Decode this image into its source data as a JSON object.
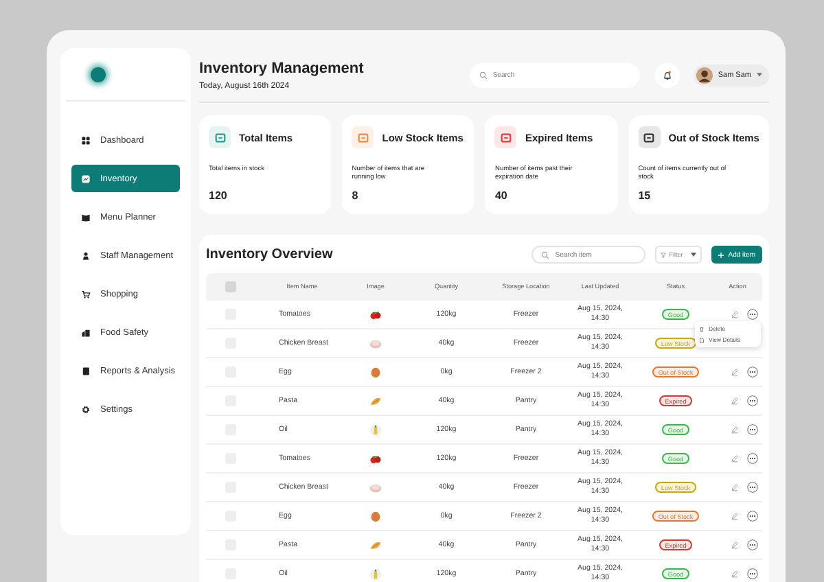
{
  "sidebar": {
    "items": [
      {
        "label": "Dashboard",
        "selected": false
      },
      {
        "label": "Inventory",
        "selected": true
      },
      {
        "label": "Menu Planner",
        "selected": false
      },
      {
        "label": "Staff Management",
        "selected": false
      },
      {
        "label": "Shopping",
        "selected": false
      },
      {
        "label": "Food Safety",
        "selected": false
      },
      {
        "label": "Reports & Analysis",
        "selected": false
      },
      {
        "label": "Settings",
        "selected": false
      }
    ]
  },
  "header": {
    "title": "Inventory Management",
    "date": "Today, August 16th 2024",
    "search": {
      "placeholder": "Search"
    },
    "user": {
      "name": "Sam Sam"
    }
  },
  "cards": [
    {
      "title": "Total Items",
      "description": "Total items in stock",
      "value": "120",
      "color": "#2a9d8f"
    },
    {
      "title": "Low Stock Items",
      "description": "Number of items that are running low",
      "value": "8",
      "color": "#f08a3c"
    },
    {
      "title": "Expired Items",
      "description": "Number of items past their expiration date",
      "value": "40",
      "color": "#e23b3b"
    },
    {
      "title": "Out of Stock Items",
      "description": "Count of items currently out of stock",
      "value": "15",
      "color": "#333333"
    }
  ],
  "table": {
    "title": "Inventory Overview",
    "search": {
      "placeholder": "Search item"
    },
    "filter": "Filter",
    "add_button": "Add item",
    "all_checked": false,
    "columns": [
      "Item Name",
      "Image",
      "Quantity",
      "Storage Location",
      "Last Updated",
      "Status",
      "Action"
    ],
    "rows": [
      {
        "checked": false,
        "name": "Tomatoes",
        "kind": "tomato",
        "quantity": "120kg",
        "location": "Freezer",
        "updated": "Aug 15, 2024, 14:30",
        "status": "Good",
        "color": "#3bb54a",
        "menu": [
          {
            "label": "Delete"
          },
          {
            "label": "View Details"
          }
        ]
      },
      {
        "checked": false,
        "name": "Chicken Breast",
        "kind": "chicken",
        "quantity": "40kg",
        "location": "Freezer",
        "updated": "Aug 15, 2024, 14:30",
        "status": "Low Stock",
        "color": "#c9a800"
      },
      {
        "checked": false,
        "name": "Egg",
        "kind": "egg",
        "quantity": "0kg",
        "location": "Freezer 2",
        "updated": "Aug 15, 2024, 14:30",
        "status": "Out of Stock",
        "color": "#e0782f"
      },
      {
        "checked": false,
        "name": "Pasta",
        "kind": "pasta",
        "quantity": "40kg",
        "location": "Pantry",
        "updated": "Aug 15, 2024, 14:30",
        "status": "Expired",
        "color": "#d93636"
      },
      {
        "checked": false,
        "name": "Oil",
        "kind": "oil",
        "quantity": "120kg",
        "location": "Pantry",
        "updated": "Aug 15, 2024, 14:30",
        "status": "Good",
        "color": "#3bb54a"
      },
      {
        "checked": false,
        "name": "Tomatoes",
        "kind": "tomato",
        "quantity": "120kg",
        "location": "Freezer",
        "updated": "Aug 15, 2024, 14:30",
        "status": "Good",
        "color": "#3bb54a"
      },
      {
        "checked": false,
        "name": "Chicken Breast",
        "kind": "chicken",
        "quantity": "40kg",
        "location": "Freezer",
        "updated": "Aug 15, 2024, 14:30",
        "status": "Low Stock",
        "color": "#c9a800"
      },
      {
        "checked": false,
        "name": "Egg",
        "kind": "egg",
        "quantity": "0kg",
        "location": "Freezer 2",
        "updated": "Aug 15, 2024, 14:30",
        "status": "Out of Stock",
        "color": "#e0782f"
      },
      {
        "checked": false,
        "name": "Pasta",
        "kind": "pasta",
        "quantity": "40kg",
        "location": "Pantry",
        "updated": "Aug 15, 2024, 14:30",
        "status": "Expired",
        "color": "#d93636"
      },
      {
        "checked": false,
        "name": "Oil",
        "kind": "oil",
        "quantity": "120kg",
        "location": "Pantry",
        "updated": "Aug 15, 2024, 14:30",
        "status": "Good",
        "color": "#3bb54a"
      }
    ]
  }
}
